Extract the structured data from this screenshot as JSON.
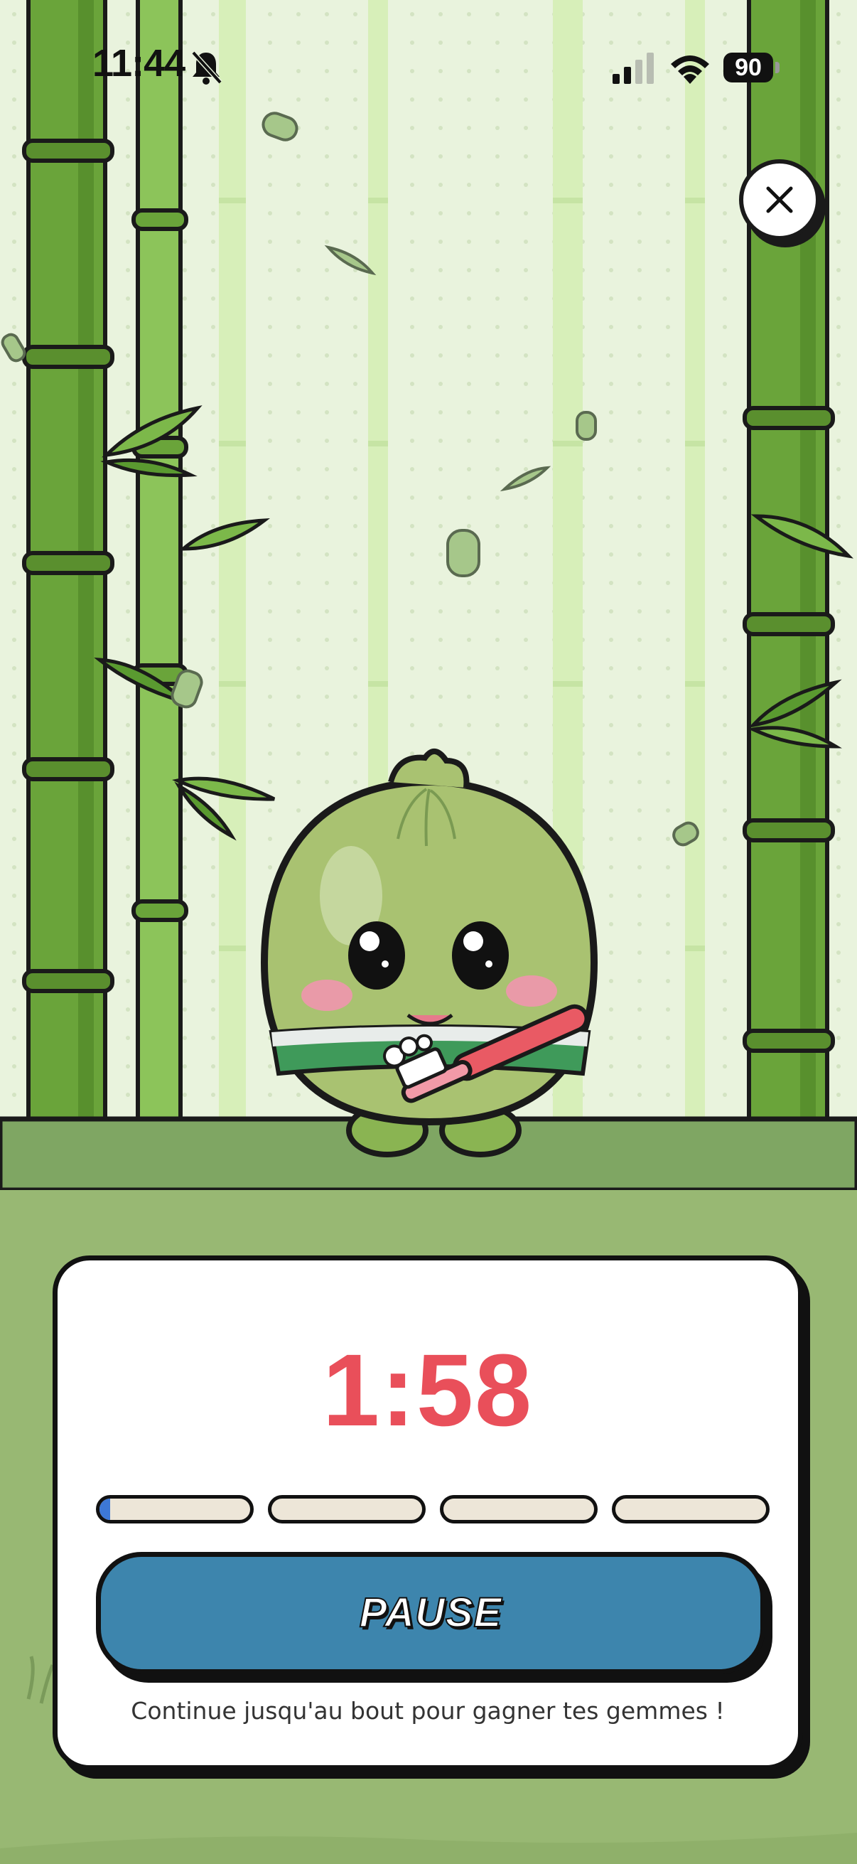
{
  "status_bar": {
    "time": "11:44",
    "battery": "90",
    "icons": [
      "bell-slash-icon",
      "cellular-signal-icon",
      "wifi-icon",
      "battery-icon"
    ]
  },
  "close_button": {
    "icon": "close-icon"
  },
  "timer": {
    "value": "1:58"
  },
  "progress": {
    "segments": 4,
    "current_segment_fill": 0.07
  },
  "pause_button": {
    "label": "PAUSE"
  },
  "hint": {
    "text": "Continue jusqu'au bout pour gagner tes gemmes !"
  },
  "colors": {
    "timer": "#e94f5a",
    "pause_button": "#3d85ad",
    "progress_fill": "#3d78d6",
    "background": "#e9f3dd",
    "ground": "#98b873"
  }
}
